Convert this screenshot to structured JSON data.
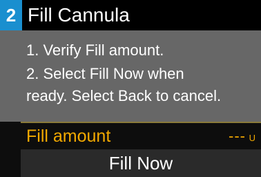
{
  "header": {
    "step_number": "2",
    "title": "Fill Cannula"
  },
  "instructions": {
    "line1": "1. Verify Fill amount.",
    "line2": "2. Select Fill Now when",
    "line3": "ready. Select Back to cancel."
  },
  "fill_amount": {
    "label": "Fill amount",
    "value": "---",
    "unit": "U"
  },
  "actions": {
    "fill_now_label": "Fill Now"
  },
  "colors": {
    "step_badge": "#1a8fcf",
    "highlight_text": "#f2a900",
    "body_background": "#676767"
  }
}
